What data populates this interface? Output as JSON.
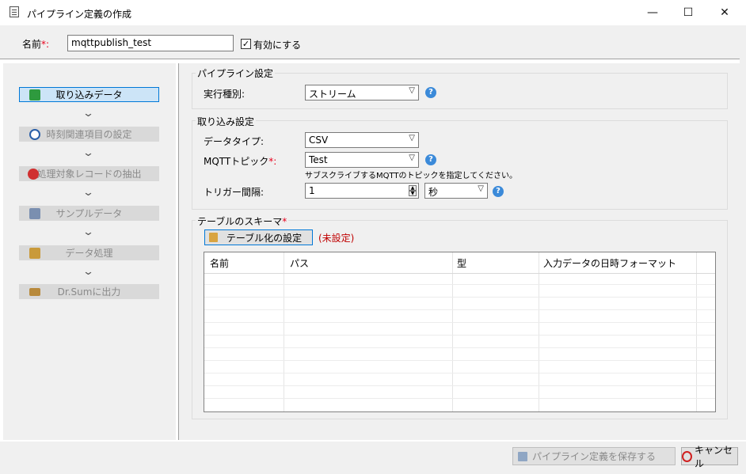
{
  "window": {
    "title": "パイプライン定義の作成",
    "minimize": "—",
    "maximize": "☐",
    "close": "✕"
  },
  "header": {
    "name_label": "名前",
    "required_mark": "*:",
    "name_value": "mqttpublish_test",
    "enabled_label": "有効にする",
    "enabled_checked": "✓"
  },
  "steps": [
    {
      "label": "取り込みデータ",
      "state": "active"
    },
    {
      "label": "時刻関連項目の設定",
      "state": "disabled"
    },
    {
      "label": "処理対象レコードの抽出",
      "state": "disabled"
    },
    {
      "label": "サンプルデータ",
      "state": "disabled"
    },
    {
      "label": "データ処理",
      "state": "disabled"
    },
    {
      "label": "Dr.Sumに出力",
      "state": "disabled"
    }
  ],
  "chevron": "⌄",
  "pipeline_settings": {
    "title": "パイプライン設定",
    "exec_type_label": "実行種別:",
    "exec_type_value": "ストリーム"
  },
  "ingest_settings": {
    "title": "取り込み設定",
    "data_type_label": "データタイプ:",
    "data_type_value": "CSV",
    "topic_label": "MQTTトピック",
    "topic_required": "*:",
    "topic_value": "Test",
    "topic_hint": "サブスクライブするMQTTのトピックを指定してください。",
    "trigger_label": "トリガー間隔:",
    "trigger_value": "1",
    "trigger_unit": "秒"
  },
  "schema": {
    "title": "テーブルのスキーマ",
    "required_mark": "*",
    "button_label": "テーブル化の設定",
    "status": "(未設定)",
    "columns": [
      "名前",
      "パス",
      "型",
      "入力データの日時フォーマット"
    ]
  },
  "footer": {
    "save_label": "パイプライン定義を保存する",
    "cancel_label": "キャンセル"
  },
  "help_glyph": "?",
  "colors": {
    "accent": "#0078d7",
    "help": "#3b8ad9",
    "required": "#e8001c",
    "unset": "#c00000"
  }
}
